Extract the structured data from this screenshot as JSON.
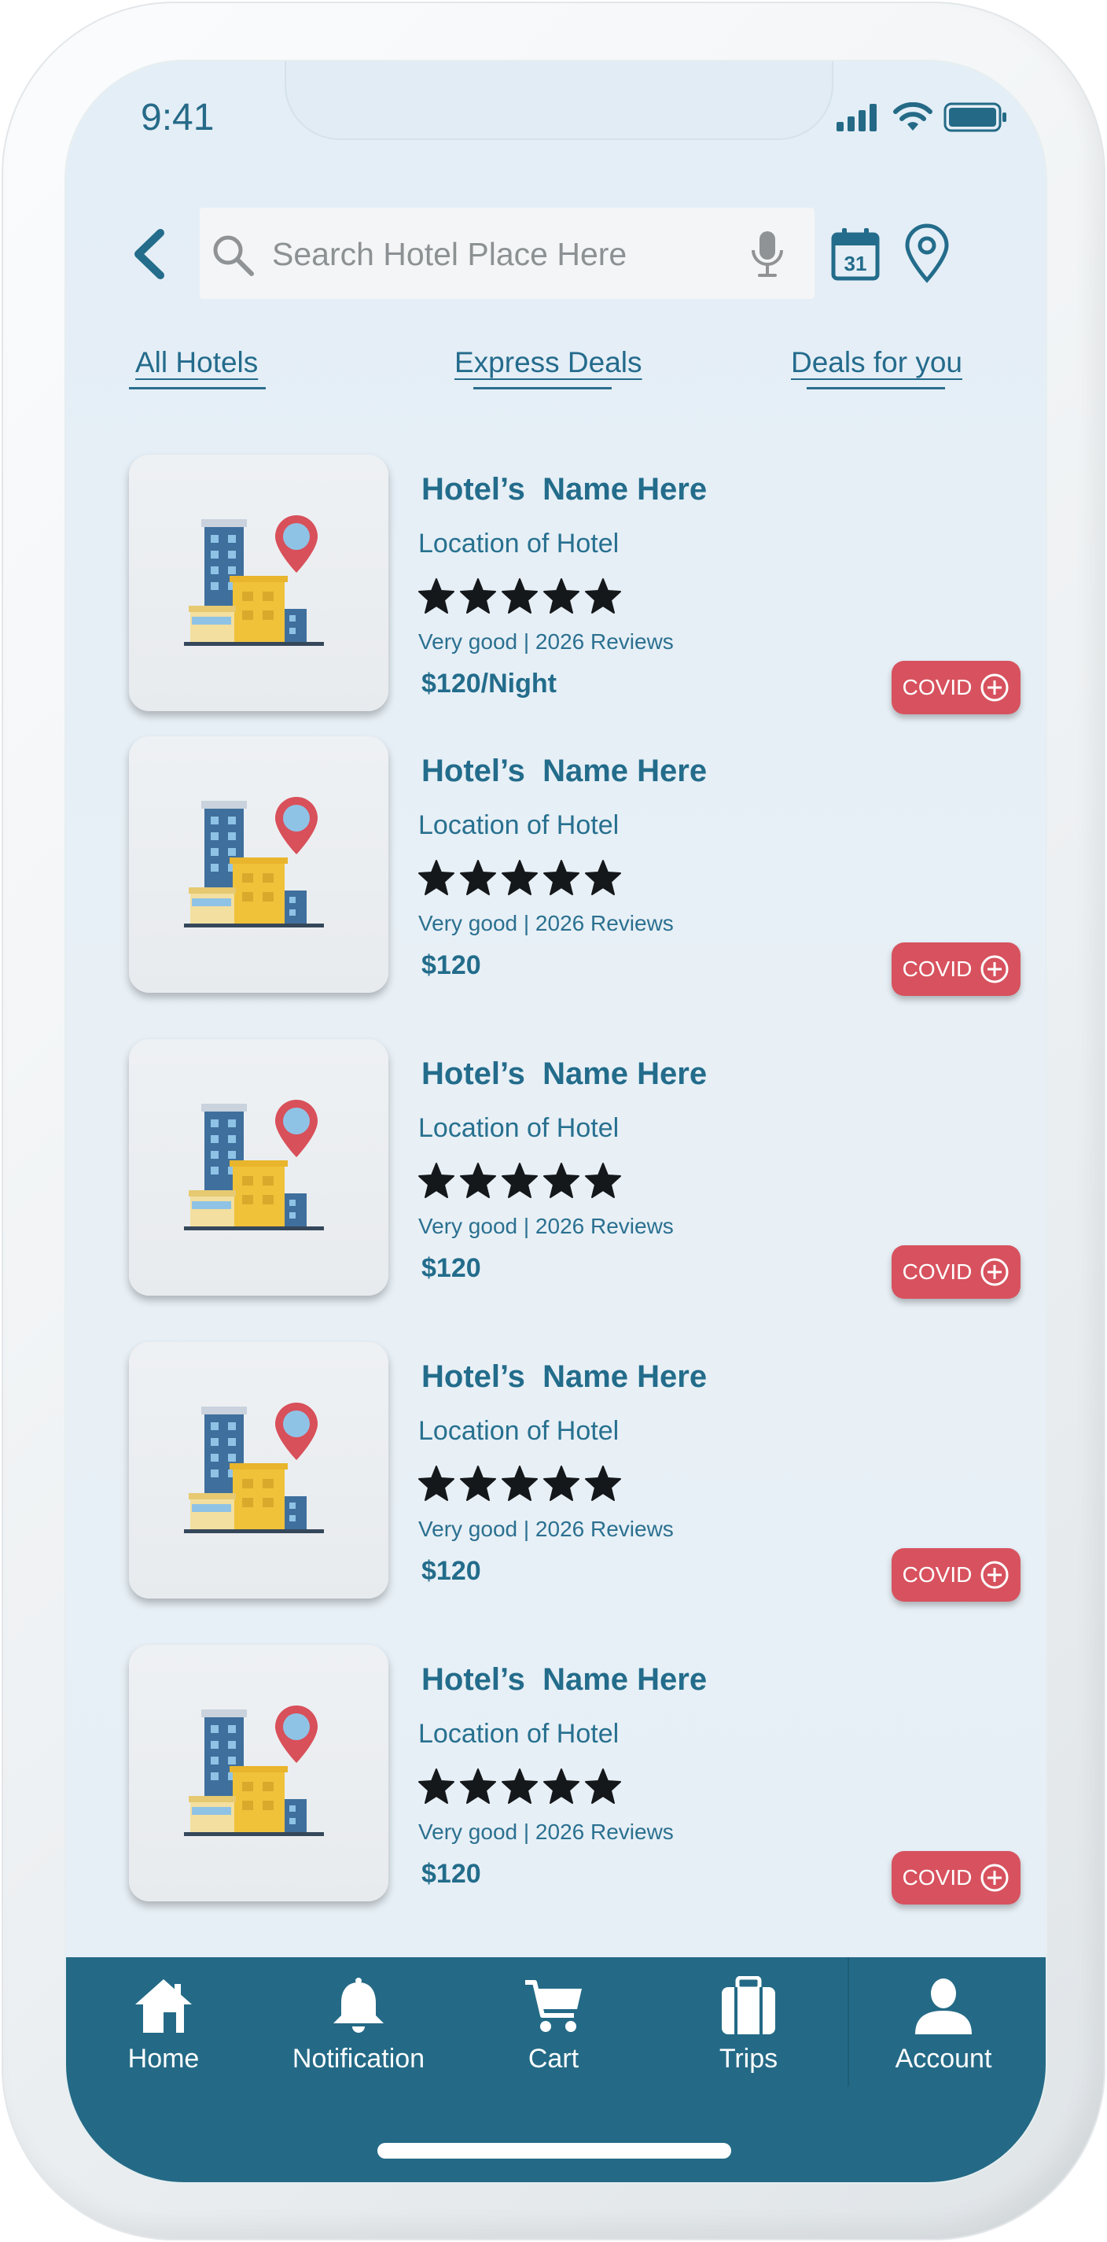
{
  "status": {
    "time": "9:41"
  },
  "search": {
    "placeholder": "Search Hotel Place Here"
  },
  "tabs": [
    {
      "label": "All Hotels"
    },
    {
      "label": "Express Deals"
    },
    {
      "label": "Deals for you"
    }
  ],
  "hotels": [
    {
      "name": "Hotel’s  Name Here",
      "location": "Location of Hotel",
      "rating": 5,
      "reviews": "Very good | 2026 Reviews",
      "price": "$120/Night",
      "badge": "COVID"
    },
    {
      "name": "Hotel’s  Name Here",
      "location": "Location of Hotel",
      "rating": 5,
      "reviews": "Very good | 2026 Reviews",
      "price": "$120",
      "badge": "COVID"
    },
    {
      "name": "Hotel’s  Name Here",
      "location": "Location of Hotel",
      "rating": 5,
      "reviews": "Very good | 2026 Reviews",
      "price": "$120",
      "badge": "COVID"
    },
    {
      "name": "Hotel’s  Name Here",
      "location": "Location of Hotel",
      "rating": 5,
      "reviews": "Very good | 2026 Reviews",
      "price": "$120",
      "badge": "COVID"
    },
    {
      "name": "Hotel’s  Name Here",
      "location": "Location of Hotel",
      "rating": 5,
      "reviews": "Very good | 2026 Reviews",
      "price": "$120",
      "badge": "COVID"
    }
  ],
  "nav": [
    {
      "label": "Home",
      "icon": "home-icon"
    },
    {
      "label": "Notification",
      "icon": "bell-icon"
    },
    {
      "label": "Cart",
      "icon": "cart-icon"
    },
    {
      "label": "Trips",
      "icon": "briefcase-icon"
    },
    {
      "label": "Account",
      "icon": "user-icon"
    }
  ],
  "colors": {
    "accent": "#246a86",
    "covid_badge": "#d7525e",
    "screen_bg": "#e6eff6"
  }
}
